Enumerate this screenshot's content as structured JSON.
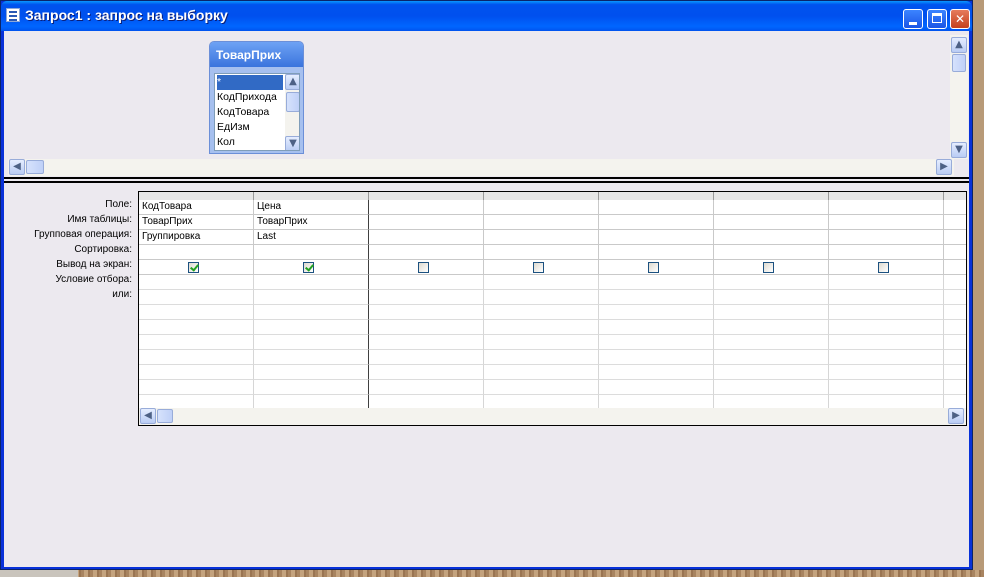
{
  "window": {
    "title": "Запрос1 : запрос на выборку",
    "buttons": {
      "minimize": "minimize",
      "maximize": "maximize",
      "close": "✕"
    }
  },
  "table_box": {
    "title": "ТоварПрих",
    "fields": [
      "*",
      "КодПрихода",
      "КодТовара",
      "ЕдИзм",
      "Кол"
    ],
    "selected_index": 0
  },
  "grid": {
    "row_labels": [
      "Поле:",
      "Имя таблицы:",
      "Групповая операция:",
      "Сортировка:",
      "Вывод на экран:",
      "Условие отбора:",
      "или:"
    ],
    "columns": [
      {
        "field": "КодТовара",
        "table": "ТоварПрих",
        "group": "Группировка",
        "sort": "",
        "show": true
      },
      {
        "field": "Цена",
        "table": "ТоварПрих",
        "group": "Last",
        "sort": "",
        "show": true
      },
      {
        "field": "",
        "table": "",
        "group": "",
        "sort": "",
        "show": false
      },
      {
        "field": "",
        "table": "",
        "group": "",
        "sort": "",
        "show": false
      },
      {
        "field": "",
        "table": "",
        "group": "",
        "sort": "",
        "show": false
      },
      {
        "field": "",
        "table": "",
        "group": "",
        "sort": "",
        "show": false
      },
      {
        "field": "",
        "table": "",
        "group": "",
        "sort": "",
        "show": false
      }
    ]
  },
  "icons": {
    "window": "query-window-icon",
    "scroll_up": "chevron-up-icon",
    "scroll_down": "chevron-down-icon",
    "scroll_left": "chevron-left-icon",
    "scroll_right": "chevron-right-icon"
  },
  "colors": {
    "title_bar": "#0053ee",
    "close_button": "#c4401c",
    "selection": "#316ac5",
    "checkbox_check": "#21a121",
    "pane_background": "#ece9ef"
  }
}
